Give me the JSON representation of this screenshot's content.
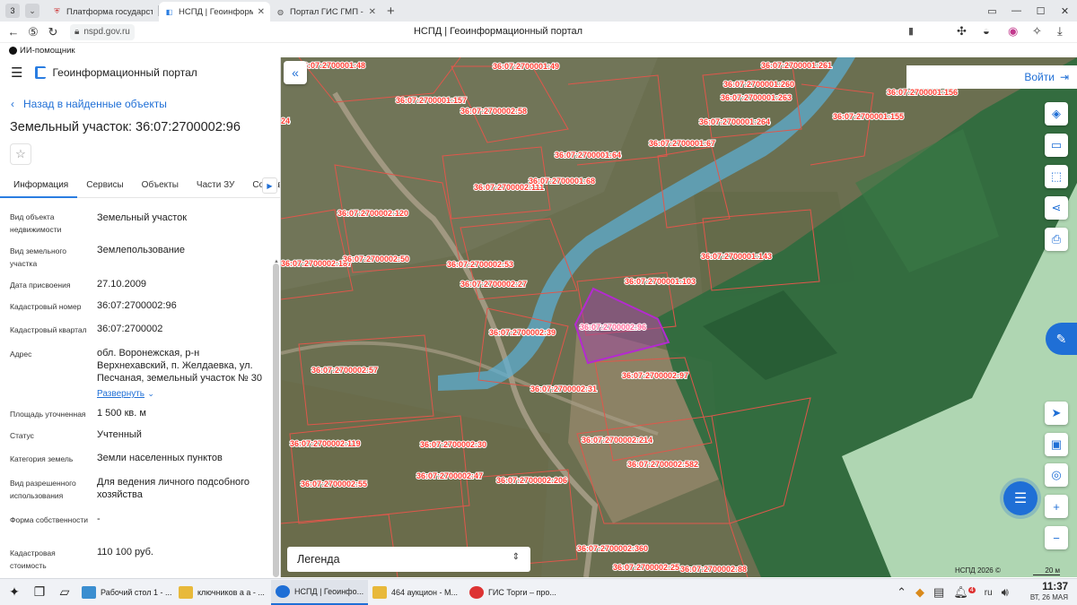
{
  "browser": {
    "tab_counter": "3",
    "tabs": [
      {
        "title": "Платформа государственных",
        "active": false
      },
      {
        "title": "НСПД | Геоинформационный",
        "active": true
      },
      {
        "title": "Портал ГИС ГМП - Начало",
        "active": false
      }
    ],
    "url": "nspd.gov.ru",
    "page_title": "НСПД | Геоинформационный портал",
    "bookmark": "ИИ-помощник"
  },
  "panel": {
    "brand": "Геоинформационный портал",
    "back_label": "Назад в найденные объекты",
    "object_title": "Земельный участок: 36:07:2700002:96",
    "tabs": [
      "Информация",
      "Сервисы",
      "Объекты",
      "Части ЗУ",
      "Состав"
    ],
    "properties": [
      {
        "label": "Вид объекта недвижимости",
        "value": "Земельный участок"
      },
      {
        "label": "Вид земельного участка",
        "value": "Землепользование"
      },
      {
        "label": "Дата присвоения",
        "value": "27.10.2009"
      },
      {
        "label": "Кадастровый номер",
        "value": "36:07:2700002:96"
      },
      {
        "label": "Кадастровый квартал",
        "value": "36:07:2700002"
      },
      {
        "label": "Адрес",
        "value": "обл. Воронежская, р-н Верхнехавский, п. Желдаевка, ул. Песчаная, земельный участок № 30"
      },
      {
        "label": "Площадь уточненная",
        "value": "1 500 кв. м"
      },
      {
        "label": "Статус",
        "value": "Учтенный"
      },
      {
        "label": "Категория земель",
        "value": "Земли населенных пунктов"
      },
      {
        "label": "Вид разрешенного использования",
        "value": "Для ведения личного подсобного хозяйства"
      },
      {
        "label": "Форма собственности",
        "value": "-"
      },
      {
        "label": "Кадастровая стоимость",
        "value": "110 100 руб."
      }
    ],
    "expand_label": "Развернуть"
  },
  "map": {
    "login_label": "Войти",
    "legend_label": "Легенда",
    "attribution": "НСПД 2026 ©",
    "scale_label": "20 м",
    "colors": {
      "forest_zone": "#2f6b3e",
      "stream": "#5bb0d9",
      "selected_parcel": "#a03da8",
      "parcel_line": "#e0574b",
      "label": "#ff3b2f",
      "light_zone": "#b6dcb8"
    },
    "parcel_labels": [
      "36:07:2700001:48",
      "36:07:2700001:49",
      "36:07:2700001:261",
      "36:07:2700001:260",
      "36:07:2700001:157",
      "36:07:2700002:58",
      "36:07:2700001:263",
      "36:07:2700001:156",
      "36:07:2700001:264",
      "36:07:2700001:155",
      "36:07:2700001:67",
      "36:07:2700001:64",
      "36:07:2700002:111",
      "36:07:2700001:68",
      "36:07:2700002:120",
      "36:07:2700001:143",
      "36:07:2700002:187",
      "36:07:2700002:50",
      "36:07:2700002:53",
      "36:07:2700001:103",
      "36:07:2700002:27",
      "36:07:2700002:96",
      "36:07:2700002:39",
      "36:07:2700002:57",
      "36:07:2700002:97",
      "36:07:2700002:31",
      "36:07:2700002:119",
      "36:07:2700002:214",
      "36:07:2700002:30",
      "36:07:2700002:582",
      "36:07:2700002:47",
      "36:07:2700002:55",
      "36:07:2700002:206",
      "36:07:2700002:360",
      "36:07:2700002:25",
      "36:07:2700002:88",
      "24"
    ]
  },
  "taskbar": {
    "apps": [
      {
        "title": "Рабочий стол 1 - ...",
        "active": false
      },
      {
        "title": "ключников а а - ...",
        "active": false
      },
      {
        "title": "НСПД | Геоинфо...",
        "active": true
      },
      {
        "title": "464 аукцион - М...",
        "active": false
      },
      {
        "title": "ГИС Торги – про...",
        "active": false
      }
    ],
    "notification_count": "4",
    "lang": "ru",
    "time": "11:37",
    "date": "ВТ, 26 МАЯ"
  }
}
